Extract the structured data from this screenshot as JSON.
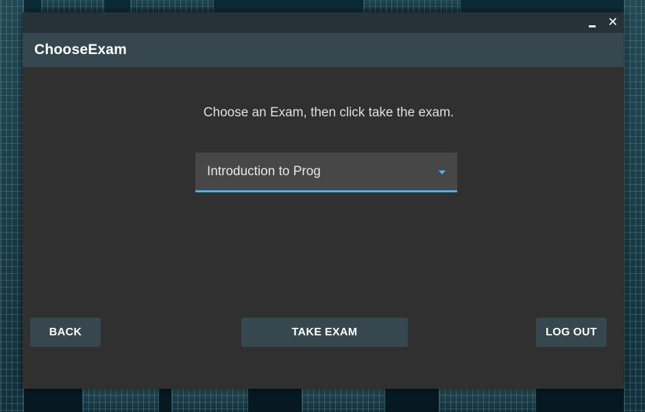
{
  "window": {
    "controls": {
      "minimize_icon": "minimize-icon",
      "close_glyph": "✕"
    }
  },
  "appbar": {
    "title": "ChooseExam"
  },
  "main": {
    "instruction": "Choose an Exam, then click take the exam.",
    "exam_select": {
      "selected_value": "Introduction to Prog",
      "icon": "dropdown-arrow-icon"
    }
  },
  "buttons": {
    "back": "BACK",
    "take_exam": "TAKE EXAM",
    "log_out": "LOG OUT"
  },
  "colors": {
    "accent": "#4fb3f0",
    "titlebar": "#263238",
    "appbar": "#37474f",
    "window_bg": "#303030",
    "button_bg": "#37474f"
  }
}
